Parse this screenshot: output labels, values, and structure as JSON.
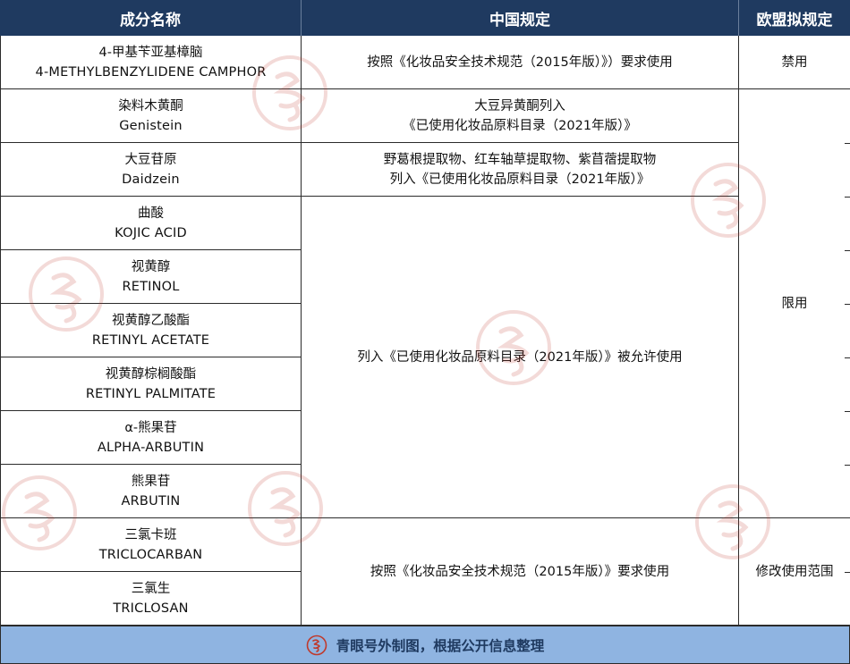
{
  "headers": {
    "col1": "成分名称",
    "col2": "中国规定",
    "col3": "欧盟拟规定"
  },
  "rows": [
    {
      "cn": "4-甲基苄亚基樟脑",
      "en": "4-METHYLBENZYLIDENE CAMPHOR"
    },
    {
      "cn": "染料木黄酮",
      "en": "Genistein"
    },
    {
      "cn": "大豆苷原",
      "en": "Daidzein"
    },
    {
      "cn": "曲酸",
      "en": "KOJIC ACID"
    },
    {
      "cn": "视黄醇",
      "en": "RETINOL"
    },
    {
      "cn": "视黄醇乙酸酯",
      "en": "RETINYL ACETATE"
    },
    {
      "cn": "视黄醇棕榈酸酯",
      "en": "RETINYL PALMITATE"
    },
    {
      "cn": "α-熊果苷",
      "en": "ALPHA-ARBUTIN"
    },
    {
      "cn": "熊果苷",
      "en": "ARBUTIN"
    },
    {
      "cn": "三氯卡班",
      "en": "TRICLOCARBAN"
    },
    {
      "cn": "三氯生",
      "en": "TRICLOSAN"
    }
  ],
  "china": {
    "r1": "按照《化妆品安全技术规范（2015年版）》）要求使用",
    "r2_line1": "大豆异黄酮列入",
    "r2_line2": "《已使用化妆品原料目录（2021年版）》",
    "r3_line1": "野葛根提取物、红车轴草提取物、紫苜蓿提取物",
    "r3_line2": "列入《已使用化妆品原料目录（2021年版）》",
    "r4_9": "列入《已使用化妆品原料目录（2021年版）》被允许使用",
    "r10_11": "按照《化妆品安全技术规范（2015年版）》要求使用"
  },
  "eu": {
    "r1": "禁用",
    "r2_9": "限用",
    "r10_11": "修改使用范围"
  },
  "footer": {
    "text": "青眼号外制图，根据公开信息整理",
    "logo_icon": "qingyan-seal-logo"
  },
  "colors": {
    "header_bg": "#1f3a60",
    "footer_bg": "#8fb4e1",
    "watermark": "#c0392b"
  }
}
